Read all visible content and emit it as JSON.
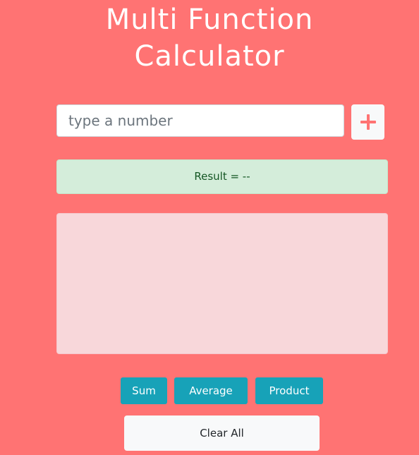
{
  "header": {
    "title_line1": "Multi Function",
    "title_line2": "Calculator"
  },
  "input": {
    "placeholder": "type a number",
    "value": ""
  },
  "add_button": {
    "icon": "plus-icon",
    "color": "#ff7373"
  },
  "result": {
    "text": "Result = --"
  },
  "numbers_list": {
    "items": []
  },
  "operations": {
    "sum_label": "Sum",
    "average_label": "Average",
    "product_label": "Product"
  },
  "clear_button": {
    "label": "Clear All"
  },
  "colors": {
    "background": "#ff7373",
    "result_bg": "#d4edda",
    "list_bg": "#f8d7da",
    "op_button_bg": "#17a2b8",
    "light_button_bg": "#f8f9fa"
  }
}
